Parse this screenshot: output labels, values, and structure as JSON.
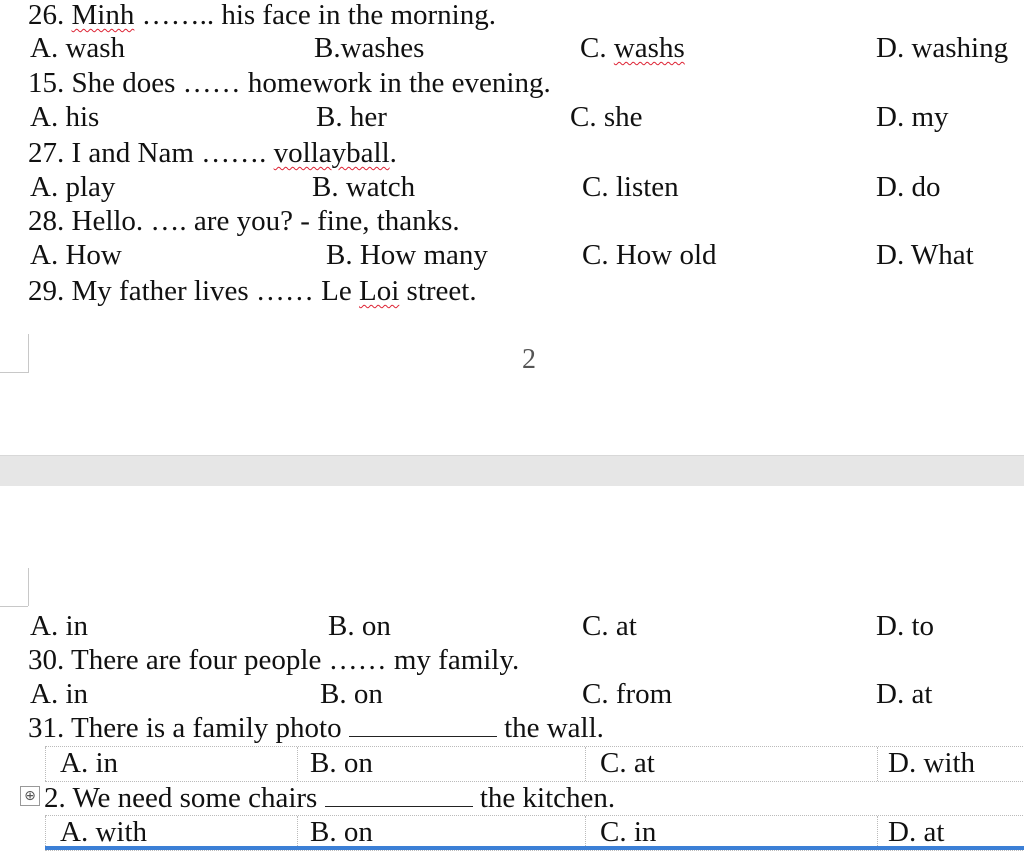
{
  "questions": [
    {
      "stem_pre": "26. ",
      "stem_word": "Minh",
      "stem_post": " …….. his  face in the morning.",
      "options": [
        "A. wash",
        "B.washes",
        "C. washs",
        "D. washing"
      ]
    },
    {
      "stem": "15. She does …… homework in the evening.",
      "options": [
        "A. his",
        "B. her",
        "C. she",
        "D. my"
      ]
    },
    {
      "stem_pre": "27. I and Nam  ……. ",
      "stem_word": "vollayball",
      "stem_post": ".",
      "options": [
        "A. play",
        "B. watch",
        "C. listen",
        "D. do"
      ]
    },
    {
      "stem": "28. Hello. …. are you?   - fine, thanks.",
      "options": [
        "A. How",
        "B. How many",
        "C. How old",
        "D. What"
      ]
    },
    {
      "stem_pre": "29. My father lives …… Le ",
      "stem_word": "Loi",
      "stem_post": " street."
    },
    {
      "options": [
        "A. in",
        "B. on",
        "C. at",
        "D. to"
      ]
    },
    {
      "stem": "30. There are four people …… my family.",
      "options": [
        "A. in",
        "B. on",
        "C. from",
        "D. at"
      ]
    },
    {
      "stem_pre": "31.  There is a family photo ",
      "stem_post": " the wall.",
      "options": [
        "A.  in",
        "B.  on",
        "C.  at",
        "D.  with"
      ]
    },
    {
      "stem_pre": "2.  We need some chairs ",
      "stem_post": " the kitchen.",
      "options": [
        "A.  with",
        "B.  on",
        "C.  in",
        "D.  at"
      ]
    }
  ],
  "page_number": "2",
  "move_handle_icon": "⊕",
  "colors": {
    "spell_check": "#d22233",
    "selection_bar": "#3b7fd6"
  }
}
